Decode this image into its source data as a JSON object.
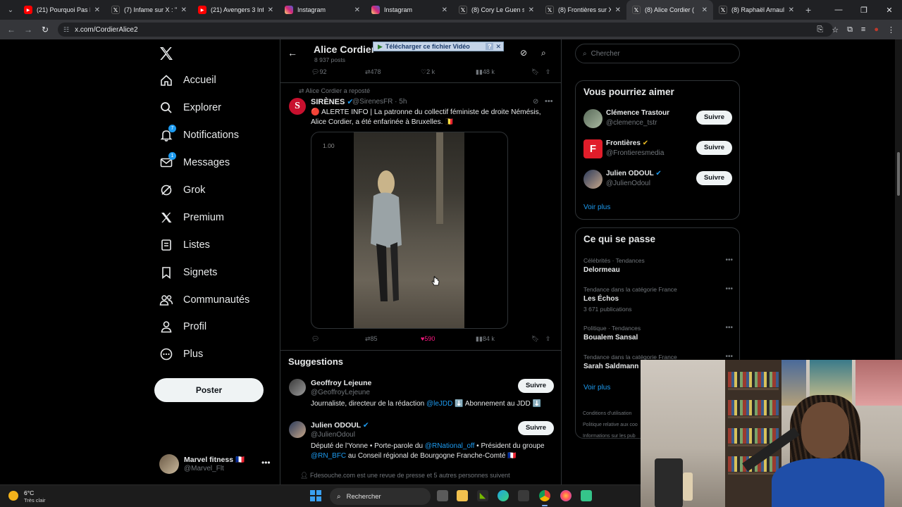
{
  "browser": {
    "tabs": [
      {
        "title": "(21) Pourquoi Pas PK",
        "icon": "youtube-icon",
        "color": "#ff0000",
        "active": false
      },
      {
        "title": "(7) Infame sur X : \"Ce",
        "icon": "x-icon",
        "color": "#000000",
        "active": false
      },
      {
        "title": "(21) Avengers 3 Infini",
        "icon": "youtube-icon",
        "color": "#ff0000",
        "active": false
      },
      {
        "title": "Instagram",
        "icon": "instagram-icon",
        "color": "#d62976",
        "active": false
      },
      {
        "title": "Instagram",
        "icon": "instagram-icon",
        "color": "#d62976",
        "active": false
      },
      {
        "title": "(8) Cory Le Guen sur",
        "icon": "x-icon",
        "color": "#000000",
        "active": false
      },
      {
        "title": "(8) Frontières sur X :",
        "icon": "x-icon",
        "color": "#000000",
        "active": false
      },
      {
        "title": "(8) Alice Cordier (",
        "icon": "x-icon",
        "color": "#000000",
        "active": true
      },
      {
        "title": "(8) Raphaël Arnault s",
        "icon": "x-icon",
        "color": "#000000",
        "active": false
      }
    ],
    "url": "x.com/CordierAlice2"
  },
  "sidebar": {
    "items": [
      {
        "label": "Accueil",
        "icon": "home-icon",
        "badge": ""
      },
      {
        "label": "Explorer",
        "icon": "search-icon",
        "badge": ""
      },
      {
        "label": "Notifications",
        "icon": "bell-icon",
        "badge": "7"
      },
      {
        "label": "Messages",
        "icon": "envelope-icon",
        "badge": "1"
      },
      {
        "label": "Grok",
        "icon": "grok-icon",
        "badge": ""
      },
      {
        "label": "Premium",
        "icon": "x-icon",
        "badge": ""
      },
      {
        "label": "Listes",
        "icon": "list-icon",
        "badge": ""
      },
      {
        "label": "Signets",
        "icon": "bookmark-icon",
        "badge": ""
      },
      {
        "label": "Communautés",
        "icon": "people-icon",
        "badge": ""
      },
      {
        "label": "Profil",
        "icon": "person-icon",
        "badge": ""
      },
      {
        "label": "Plus",
        "icon": "more-circle-icon",
        "badge": ""
      }
    ],
    "post_button": "Poster",
    "account": {
      "name": "Marvel fitness 🇫🇷",
      "handle": "@Marvel_Flt"
    }
  },
  "profile_header": {
    "title": "Alice Cordier",
    "posts": "8 937 posts",
    "download_bar": "Télécharger ce fichier Vidéo"
  },
  "prev_tweet_actions": {
    "replies": "92",
    "reposts": "478",
    "likes": "2 k",
    "views": "48 k"
  },
  "tweet": {
    "repost_by": "Alice Cordier a reposté",
    "author": "SIRÈNES",
    "handle": "@SirenesFR · 5h",
    "text": "🔴 ALERTE INFO | La patronne du collectif féministe de droite Némésis, Alice Cordier, a été enfarinée à Bruxelles. 🇧🇪",
    "video_speed": "1.00",
    "actions": {
      "replies": "",
      "reposts": "85",
      "likes": "590",
      "views": "84 k"
    }
  },
  "suggestions": {
    "title": "Suggestions",
    "items": [
      {
        "name": "Geoffroy Lejeune",
        "handle": "@GeoffroyLejeune",
        "bio_prefix": "Journaliste, directeur de la rédaction ",
        "bio_link": "@leJDD",
        "bio_suffix": " ⬇️ Abonnement au JDD ⬇️",
        "follow": "Suivre"
      },
      {
        "name": "Julien ODOUL",
        "handle": "@JulienOdoul",
        "bio_prefix": "Député de l'Yonne • Porte-parole du ",
        "bio_link": "@RNational_off",
        "bio_mid": " • Président du groupe ",
        "bio_link2": "@RN_BFC",
        "bio_suffix": " au Conseil régional de Bourgogne Franche-Comté 🇫🇷",
        "follow": "Suivre"
      }
    ],
    "followed_by": "Fdesouche.com est une revue de presse et 5 autres personnes suivent"
  },
  "right": {
    "search_placeholder": "Chercher",
    "who_to_follow": {
      "title": "Vous pourriez aimer",
      "items": [
        {
          "name": "Clémence Trastour",
          "handle": "@clemence_tstr",
          "follow": "Suivre"
        },
        {
          "name": "Frontières",
          "handle": "@Frontieresmedia",
          "follow": "Suivre"
        },
        {
          "name": "Julien ODOUL",
          "handle": "@JulienOdoul",
          "follow": "Suivre"
        }
      ],
      "see_more": "Voir plus"
    },
    "trends": {
      "title": "Ce qui se passe",
      "items": [
        {
          "category": "Célébrités · Tendances",
          "title": "Delormeau",
          "count": ""
        },
        {
          "category": "Tendance dans la catégorie France",
          "title": "Les Échos",
          "count": "3 671 publications"
        },
        {
          "category": "Politique · Tendances",
          "title": "Boualem Sansal",
          "count": ""
        },
        {
          "category": "Tendance dans la catégorie France",
          "title": "Sarah Saldmann",
          "count": ""
        }
      ],
      "see_more": "Voir plus"
    },
    "legal": [
      "Conditions d'utilisation",
      "Politique relative aux coo",
      "Informations sur les pub"
    ]
  },
  "taskbar": {
    "temp": "6°C",
    "weather": "Très clair",
    "search": "Rechercher"
  },
  "colors": {
    "accent": "#1d9bf0",
    "like": "#f91880",
    "background": "#000000",
    "border": "#2f3336"
  }
}
